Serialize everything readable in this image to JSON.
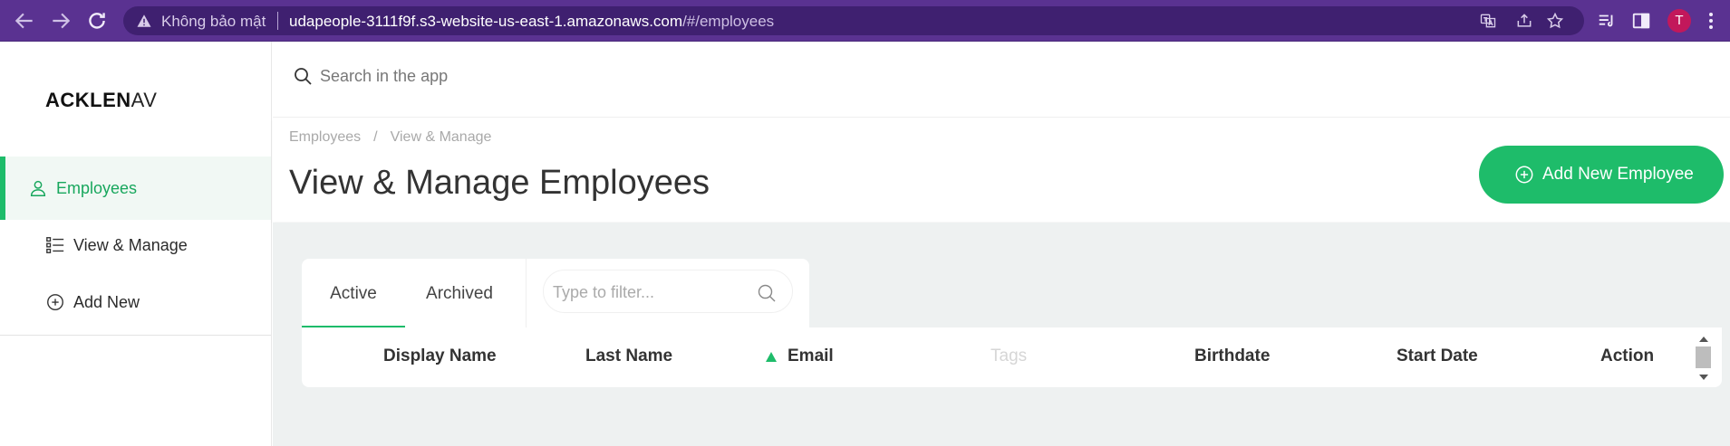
{
  "browser": {
    "security_label": "Không bảo mật",
    "url_main": "udapeople-3111f9f.s3-website-us-east-1.amazonaws.com",
    "url_fragment": "/#/employees",
    "profile_initial": "T"
  },
  "sidebar": {
    "logo": "ACKLEN",
    "logo_suffix": "AV",
    "items": [
      {
        "label": "Employees",
        "icon": "user-icon",
        "active": true
      },
      {
        "label": "View & Manage",
        "icon": "list-icon",
        "active": false
      },
      {
        "label": "Add New",
        "icon": "plus-circle-icon",
        "active": false
      }
    ]
  },
  "search": {
    "placeholder": "Search in the app"
  },
  "page": {
    "breadcrumb": [
      "Employees",
      "View & Manage"
    ],
    "breadcrumb_sep": "/",
    "title": "View & Manage Employees",
    "add_button": "Add New Employee"
  },
  "tabs": [
    {
      "label": "Active",
      "active": true
    },
    {
      "label": "Archived",
      "active": false
    }
  ],
  "filter": {
    "placeholder": "Type to filter..."
  },
  "table": {
    "columns": [
      {
        "label": "Display Name"
      },
      {
        "label": "Last Name"
      },
      {
        "label": "Email",
        "sorted": "ascending"
      },
      {
        "label": "Tags",
        "muted": true
      },
      {
        "label": "Birthdate"
      },
      {
        "label": "Start Date"
      },
      {
        "label": "Action"
      }
    ]
  },
  "colors": {
    "accent": "#1ebc6a",
    "browser_bar": "#5a3291",
    "content_bg": "#eef1f1"
  }
}
